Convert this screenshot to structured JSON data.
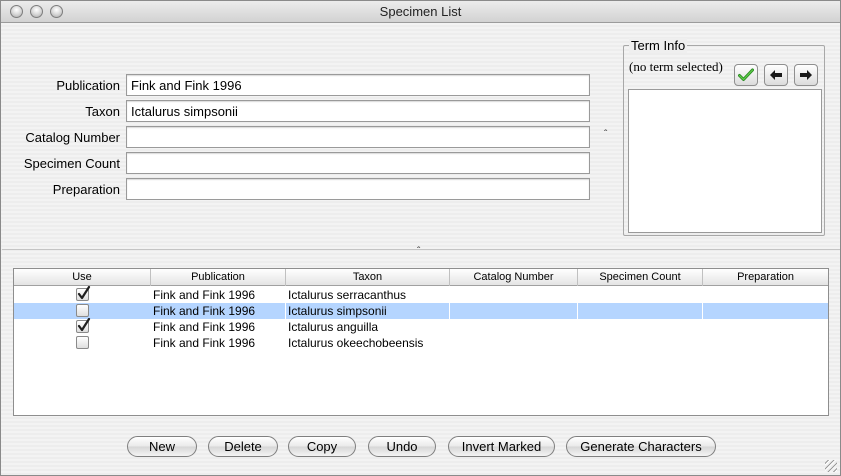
{
  "window": {
    "title": "Specimen List"
  },
  "form": {
    "publication_label": "Publication",
    "publication_value": "Fink and Fink 1996",
    "taxon_label": "Taxon",
    "taxon_value": "Ictalurus simpsonii",
    "catalog_label": "Catalog Number",
    "catalog_value": "",
    "count_label": "Specimen Count",
    "count_value": "",
    "preparation_label": "Preparation",
    "preparation_value": ""
  },
  "term_info": {
    "title": "Term Info",
    "status": "(no term selected)",
    "icons": [
      "checkmark-icon",
      "arrow-left-icon",
      "arrow-right-icon"
    ]
  },
  "splitter_glyph": "ˆ",
  "table": {
    "columns": [
      "Use",
      "Publication",
      "Taxon",
      "Catalog Number",
      "Specimen Count",
      "Preparation"
    ],
    "rows": [
      {
        "use": true,
        "publication": "Fink and Fink 1996",
        "taxon": "Ictalurus serracanthus",
        "catalog": "",
        "count": "",
        "preparation": ""
      },
      {
        "use": false,
        "publication": "Fink and Fink 1996",
        "taxon": "Ictalurus simpsonii",
        "catalog": "",
        "count": "",
        "preparation": "",
        "selected": true
      },
      {
        "use": true,
        "publication": "Fink and Fink 1996",
        "taxon": "Ictalurus anguilla",
        "catalog": "",
        "count": "",
        "preparation": ""
      },
      {
        "use": false,
        "publication": "Fink and Fink 1996",
        "taxon": "Ictalurus okeechobeensis",
        "catalog": "",
        "count": "",
        "preparation": ""
      }
    ]
  },
  "buttons": {
    "new": "New",
    "delete": "Delete",
    "copy": "Copy",
    "undo": "Undo",
    "invert_marked": "Invert Marked",
    "generate_characters": "Generate Characters"
  },
  "colors": {
    "selection": "#b5d5ff",
    "checkmark": "#1f1f1f",
    "check_green": "#3aa52e"
  }
}
